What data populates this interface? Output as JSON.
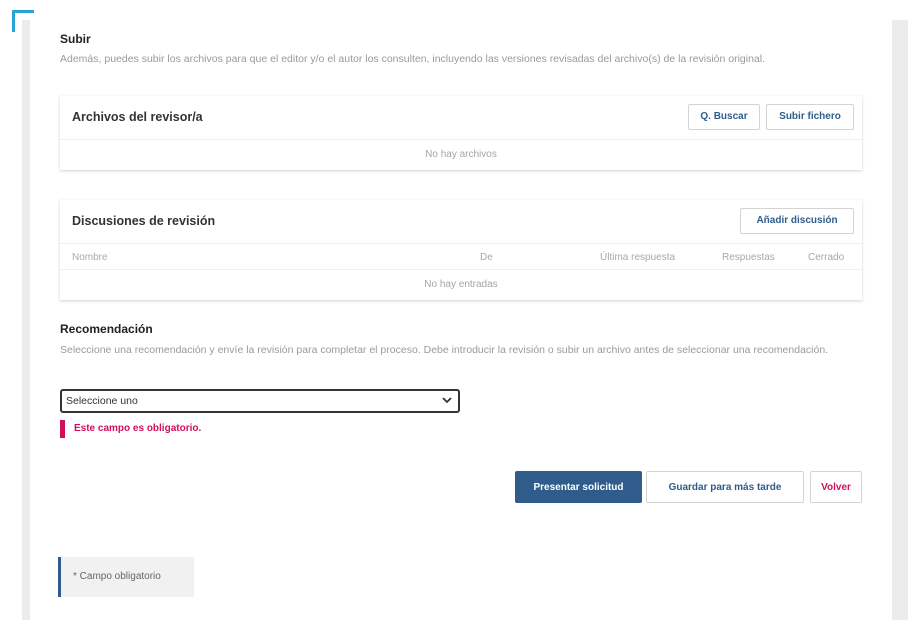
{
  "upload": {
    "title": "Subir",
    "description": "Además, puedes subir los archivos para que el editor y/o el autor los consulten, incluyendo las versiones revisadas del archivo(s) de la revisión original."
  },
  "reviewer_files": {
    "title": "Archivos del revisor/a",
    "search_label": "Q. Buscar",
    "upload_label": "Subir fichero",
    "empty_text": "No hay archivos"
  },
  "discussions": {
    "title": "Discusiones de revisión",
    "add_label": "Añadir discusión",
    "columns": [
      "Nombre",
      "De",
      "Última respuesta",
      "Respuestas",
      "Cerrado"
    ],
    "empty_text": "No hay entradas"
  },
  "recommendation": {
    "title": "Recomendación",
    "description": "Seleccione una recomendación y envíe la revisión para completar el proceso. Debe introducir la revisión o subir un archivo antes de seleccionar una recomendación.",
    "select_value": "Seleccione uno",
    "error_text": "Este campo es obligatorio."
  },
  "actions": {
    "submit_label": "Presentar solicitud",
    "save_label": "Guardar para más tarde",
    "back_label": "Volver"
  },
  "required_note": "* Campo obligatorio",
  "colors": {
    "primary": "#2f5c8a",
    "error": "#d0105a",
    "accent": "#2aa3d6"
  }
}
